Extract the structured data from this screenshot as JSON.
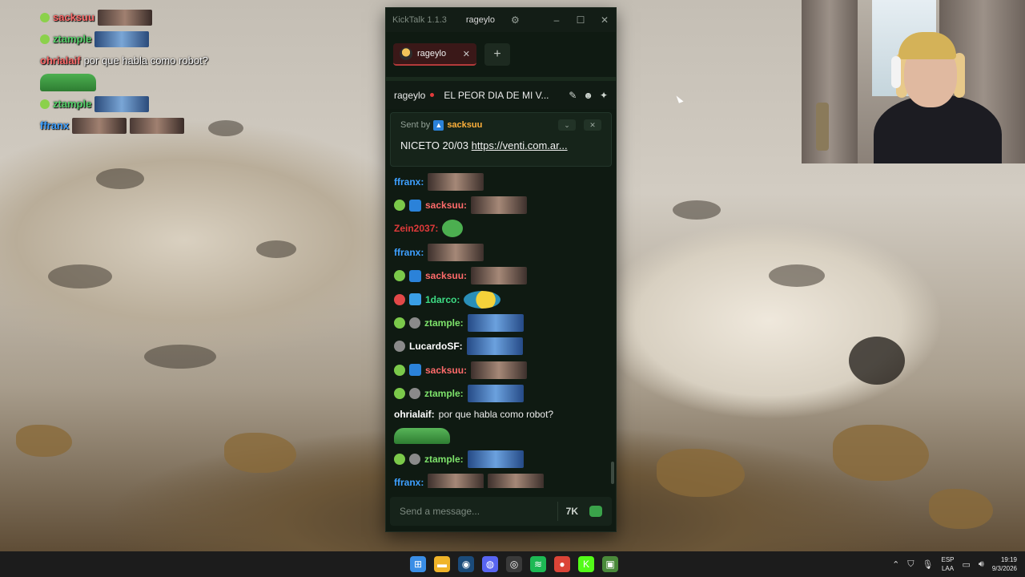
{
  "overlay": {
    "rows": [
      {
        "user": "sacksuu",
        "color": "#ff6b6b",
        "emotes": [
          "face"
        ]
      },
      {
        "user": "ztample",
        "color": "#55d16a",
        "emotes": [
          "blue"
        ]
      },
      {
        "user": "ohrialaif",
        "color": "#ff6b6b",
        "text": " por que habla como robot?"
      },
      {
        "user": "",
        "emotes": [
          "pepe"
        ]
      },
      {
        "user": "ztample",
        "color": "#55d16a",
        "emotes": [
          "blue"
        ]
      },
      {
        "user": "ffranx",
        "color": "#3ea0ff",
        "emotes": [
          "face",
          "face"
        ]
      }
    ]
  },
  "app": {
    "title": "KickTalk 1.1.3",
    "title_user": "rageylo",
    "tab_label": "rageylo",
    "channel_name": "rageylo",
    "stream_title": "EL PEOR DIA DE MI V...",
    "pinned": {
      "sent_by_label": "Sent by",
      "author": "sacksuu",
      "message_prefix": "NICETO 20/03 ",
      "link": "https://venti.com.ar..."
    },
    "messages": [
      {
        "user": "ffranx:",
        "color": "#3ea0ff",
        "badges": [],
        "emotes": [
          "face"
        ]
      },
      {
        "user": "sacksuu:",
        "color": "#ff6b6b",
        "badges": [
          "sub",
          "kick"
        ],
        "emotes": [
          "face"
        ]
      },
      {
        "user": "Zein2037:",
        "color": "#e03a3a",
        "badges": [],
        "emotes": [
          "pepe"
        ]
      },
      {
        "user": "ffranx:",
        "color": "#3ea0ff",
        "badges": [],
        "emotes": [
          "face"
        ]
      },
      {
        "user": "sacksuu:",
        "color": "#ff6b6b",
        "badges": [
          "sub",
          "kick"
        ],
        "emotes": [
          "face"
        ]
      },
      {
        "user": "1darco:",
        "color": "#3ddc84",
        "badges": [
          "red",
          "cube"
        ],
        "emotes": [
          "yellow"
        ]
      },
      {
        "user": "ztample:",
        "color": "#7ee36b",
        "badges": [
          "sub",
          "grey"
        ],
        "emotes": [
          "blue"
        ]
      },
      {
        "user": "LucardoSF:",
        "color": "#ffffff",
        "badges": [
          "grey"
        ],
        "emotes": [
          "blue"
        ]
      },
      {
        "user": "sacksuu:",
        "color": "#ff6b6b",
        "badges": [
          "sub",
          "kick"
        ],
        "emotes": [
          "face"
        ]
      },
      {
        "user": "ztample:",
        "color": "#7ee36b",
        "badges": [
          "sub",
          "grey"
        ],
        "emotes": [
          "blue"
        ]
      },
      {
        "user": "ohrialaif:",
        "color": "#ffffff",
        "badges": [],
        "text": "por que habla como robot?",
        "emotes": [
          "pepewide"
        ],
        "tall": true
      },
      {
        "user": "ztample:",
        "color": "#7ee36b",
        "badges": [
          "sub",
          "grey"
        ],
        "emotes": [
          "blue"
        ]
      },
      {
        "user": "ffranx:",
        "color": "#3ea0ff",
        "badges": [],
        "emotes": [
          "face",
          "face"
        ]
      }
    ],
    "composer_placeholder": "Send a message..."
  },
  "taskbar": {
    "apps": [
      {
        "name": "windows-start-icon",
        "color": "#3a8ee6",
        "glyph": "⊞"
      },
      {
        "name": "file-explorer-icon",
        "color": "#f0b429",
        "glyph": "▬"
      },
      {
        "name": "steam-icon",
        "color": "#1b4b7a",
        "glyph": "◉"
      },
      {
        "name": "discord-icon",
        "color": "#5865f2",
        "glyph": "◍"
      },
      {
        "name": "obs-icon",
        "color": "#3a3a3a",
        "glyph": "◎"
      },
      {
        "name": "spotify-icon",
        "color": "#1db954",
        "glyph": "≋"
      },
      {
        "name": "chrome-icon",
        "color": "#db4437",
        "glyph": "●"
      },
      {
        "name": "kick-icon",
        "color": "#53fc18",
        "glyph": "K"
      },
      {
        "name": "kicktalk-icon",
        "color": "#4a8a3a",
        "glyph": "▣"
      }
    ],
    "lang_top": "ESP",
    "lang_bottom": "LAA",
    "time": "19:19",
    "date": "9/3/2026"
  }
}
